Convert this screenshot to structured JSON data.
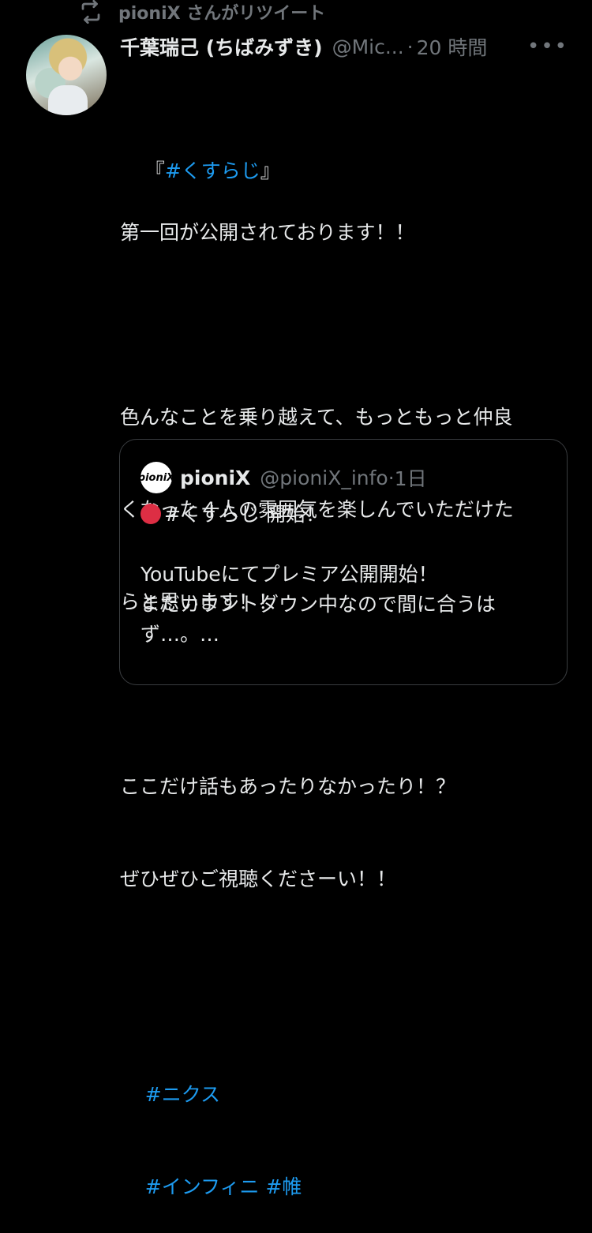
{
  "retweet": {
    "label": "pioniX さんがリツイート",
    "icon": "retweet-icon"
  },
  "tweet": {
    "author_name": "千葉瑞己 (ちばみずき)",
    "handle": "@Mic...",
    "separator": "·",
    "time": "20 時間",
    "more": "•••",
    "lines": [
      {
        "pre": "『",
        "link": "#くすらじ",
        "post": "』"
      },
      {
        "text": "第一回が公開されております！！"
      },
      {
        "text": ""
      },
      {
        "text": "色んなことを乗り越えて、もっともっと仲良"
      },
      {
        "text": "くなった４人の雰囲気を楽しんでいただけた"
      },
      {
        "text": "らと思います！！"
      },
      {
        "text": ""
      },
      {
        "text": "ここだけ話もあったりなかったり！？"
      },
      {
        "text": "ぜひぜひご視聴くださーい！！"
      },
      {
        "text": ""
      }
    ],
    "hashtags_line1": "#ニクス",
    "hashtags_line2a": "#インフィニ",
    "hashtags_line2b": "#帷"
  },
  "quote": {
    "avatar_text": "pioniX",
    "name": "pioniX",
    "handle": "@pioniX_info",
    "separator": "·",
    "time": "1日",
    "line1": "#くすらじ 開始！",
    "line2": "",
    "line3": "YouTubeにてプレミア公開開始！",
    "line4": "まだカウントダウン中なので間に合うは",
    "line5": "ず…。…"
  },
  "colors": {
    "background": "#000000",
    "link": "#1d9bf0",
    "muted": "#71767b",
    "text": "#e7e9ea",
    "red_circle": "#dd2e44"
  }
}
